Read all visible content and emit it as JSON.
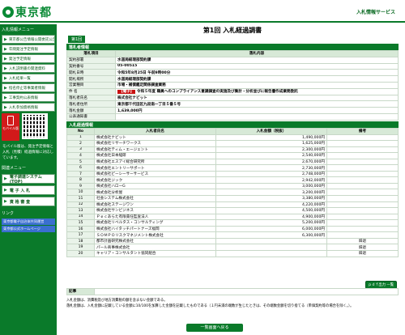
{
  "header": {
    "logo_text": "東京都",
    "system_name": "入札情報サービス"
  },
  "sidebar": {
    "menu_title": "入札情報メニュー",
    "items": [
      "東京都公告情報公開委託公告",
      "年間発注予定情報",
      "発注予定情報",
      "入札説明書の関連資料",
      "入札結果一覧",
      "指名停止等事業者情報",
      "工事契約公表情報",
      "入札参加資格情報"
    ],
    "mobile_label": "モバイル版",
    "mobile_note": "モバイル版は、発注予定情報と入札（見積）経過情報に対応しています。",
    "group_title": "関連メニュー",
    "big_items": [
      "電子調達システム(TOP)",
      "電 子 入 札",
      "資 格 審 査"
    ],
    "links_title": "リンク",
    "links": [
      "東京都電子自治体共同運営",
      "東京都公式ホームページ"
    ]
  },
  "main": {
    "page_title": "第1回 入札経過調書",
    "round_tab": "第1回",
    "section_info": "落札者情報",
    "info_headers": [
      "落札項目",
      "落札内容"
    ],
    "info_rows": [
      {
        "label": "契約部署",
        "value": "水道局経理部契約課"
      },
      {
        "label": "契約番号",
        "value": "05-00515"
      },
      {
        "label": "開札日時",
        "value": "令和5年8月25日 午前9時00分"
      },
      {
        "label": "開札場所",
        "value": "水道局経理部契約課"
      },
      {
        "label": "営業種目",
        "value": "市場・補償鑑定関係調査業務"
      }
    ],
    "subject_label": "件  名",
    "subject_badge": "【電子】",
    "subject_text": "令和５年度 職員へのコンプライアンス意識調査の実施及び集計・分析並びに報告書作成業務委託",
    "winner_rows": [
      {
        "label": "落札者氏名",
        "value": "株式会社ナビット"
      },
      {
        "label": "落札者住所",
        "value": "東京都千代田区九段南一丁目５番５号"
      },
      {
        "label": "落札金額",
        "value": "1,639,000円"
      },
      {
        "label": "公表通知書",
        "value": ""
      }
    ],
    "section_bids": "入札経過情報",
    "bid_headers": [
      "No",
      "入札者氏名",
      "入札金額（税抜）",
      "備考"
    ],
    "bids": [
      {
        "no": "1",
        "name": "株式会社ナビット",
        "amount": "1,490,000円",
        "remark": ""
      },
      {
        "no": "2",
        "name": "株式会社リサーチワークス",
        "amount": "1,625,000円",
        "remark": ""
      },
      {
        "no": "3",
        "name": "株式会社ティム・エージェント",
        "amount": "2,300,000円",
        "remark": ""
      },
      {
        "no": "4",
        "name": "株式会社日本経研",
        "amount": "2,540,000円",
        "remark": ""
      },
      {
        "no": "5",
        "name": "株式会社エスアイ総合研究所",
        "amount": "2,670,000円",
        "remark": ""
      },
      {
        "no": "6",
        "name": "株式会社エントリーサポート",
        "amount": "2,730,000円",
        "remark": ""
      },
      {
        "no": "7",
        "name": "株式会社ピーシーサーサービス",
        "amount": "2,748,000円",
        "remark": ""
      },
      {
        "no": "8",
        "name": "株式会社ジック",
        "amount": "2,942,000円",
        "remark": ""
      },
      {
        "no": "9",
        "name": "株式会社ハローG",
        "amount": "3,000,000円",
        "remark": ""
      },
      {
        "no": "10",
        "name": "株式会社分析屋",
        "amount": "3,200,000円",
        "remark": ""
      },
      {
        "no": "11",
        "name": "社会システム株式会社",
        "amount": "3,380,000円",
        "remark": ""
      },
      {
        "no": "12",
        "name": "株式会社ステージワン",
        "amount": "4,220,000円",
        "remark": ""
      },
      {
        "no": "13",
        "name": "株式会社サンビジネス",
        "amount": "4,500,000円",
        "remark": ""
      },
      {
        "no": "14",
        "name": "Ｐｅｃあらた有限責任監査法人",
        "amount": "4,900,000円",
        "remark": ""
      },
      {
        "no": "15",
        "name": "株式会社リベルタス・コンサルティング",
        "amount": "5,200,000円",
        "remark": ""
      },
      {
        "no": "16",
        "name": "株式会社ハイタッチパートナーズ福岡",
        "amount": "6,000,000円",
        "remark": ""
      },
      {
        "no": "17",
        "name": "ＳＯＭＰＯリスクマネジメント株式会社",
        "amount": "6,300,000円",
        "remark": ""
      },
      {
        "no": "18",
        "name": "都市計画研究株式会社",
        "amount": "",
        "remark": "辞退"
      },
      {
        "no": "19",
        "name": "パール商事株式会社",
        "amount": "",
        "remark": "辞退"
      },
      {
        "no": "20",
        "name": "キャリア・コンサルタント協同組合",
        "amount": "",
        "remark": "辞退"
      }
    ],
    "notes_label": "記事",
    "pdf_button": "ｐｄｆ出力 一覧",
    "footnote_1": "入札金額は、消費税及び地方消費税の額を含まない金額である。",
    "footnote_2": "落札金額は、入札金額に記載している金額に10/100を加算した金額を記載したものである（１円未満の端数が生じたときは、その端数金額を切り捨てる（単価契約等の場合を除く。）。",
    "back_button": "一覧画面へ戻る"
  }
}
